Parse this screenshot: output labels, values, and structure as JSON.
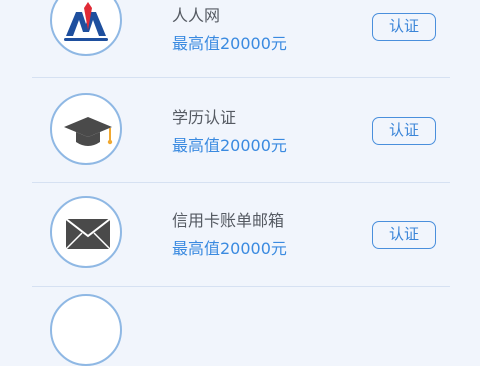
{
  "items": [
    {
      "title": "人人网",
      "subtitle": "最高值20000元",
      "button_label": "认证",
      "icon": "renren-logo-icon"
    },
    {
      "title": "学历认证",
      "subtitle": "最高值20000元",
      "button_label": "认证",
      "icon": "graduation-cap-icon"
    },
    {
      "title": "信用卡账单邮箱",
      "subtitle": "最高值20000元",
      "button_label": "认证",
      "icon": "envelope-icon"
    }
  ],
  "colors": {
    "background": "#f1f5fc",
    "accent_blue": "#3a8ae0",
    "icon_dark": "#4a4a4a",
    "renren_blue": "#1e4f9e",
    "renren_red": "#e02a35"
  }
}
